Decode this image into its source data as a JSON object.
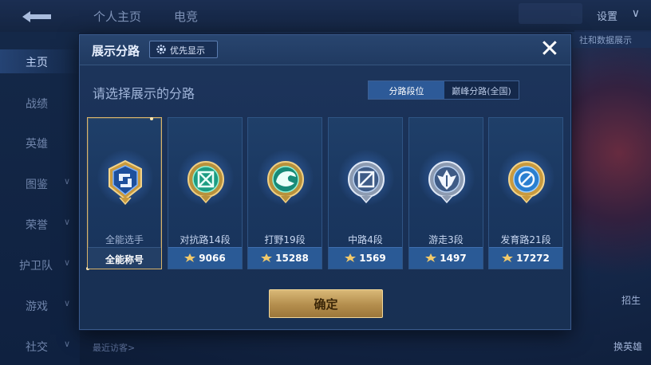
{
  "background": {
    "top_tabs": [
      "个人主页",
      "电竞"
    ],
    "settings_label": "设置",
    "right_button_label": "社和数据展示",
    "side_items": [
      {
        "label": "主页",
        "active": true
      },
      {
        "label": "战绩"
      },
      {
        "label": "英雄"
      },
      {
        "label": "图鉴"
      },
      {
        "label": "荣誉"
      },
      {
        "label": "护卫队"
      },
      {
        "label": "游戏"
      },
      {
        "label": "社交"
      }
    ],
    "right_label_1": "招生",
    "right_label_2": "换英雄",
    "bottom_text": "最近访客>"
  },
  "dialog": {
    "title": "展示分路",
    "priority_label": "优先显示",
    "close_label": "✕",
    "prompt": "请选择展示的分路",
    "segments": [
      "分路段位",
      "巅峰分路(全国)"
    ],
    "confirm_label": "确定",
    "cards": [
      {
        "name": "全能选手",
        "footer": "全能称号",
        "icon": "all-round-emblem-icon",
        "selected": true
      },
      {
        "name": "对抗路14段",
        "score": "9066",
        "icon": "clash-lane-emblem-icon"
      },
      {
        "name": "打野19段",
        "score": "15288",
        "icon": "jungle-emblem-icon"
      },
      {
        "name": "中路4段",
        "score": "1569",
        "icon": "mid-lane-emblem-icon"
      },
      {
        "name": "游走3段",
        "score": "1497",
        "icon": "roam-emblem-icon"
      },
      {
        "name": "发育路21段",
        "score": "17272",
        "icon": "farm-lane-emblem-icon"
      }
    ]
  },
  "colors": {
    "accent_gold": "#d9b46a",
    "card_footer_blue": "#2a5a96",
    "panel_bg": "#1a3157"
  }
}
